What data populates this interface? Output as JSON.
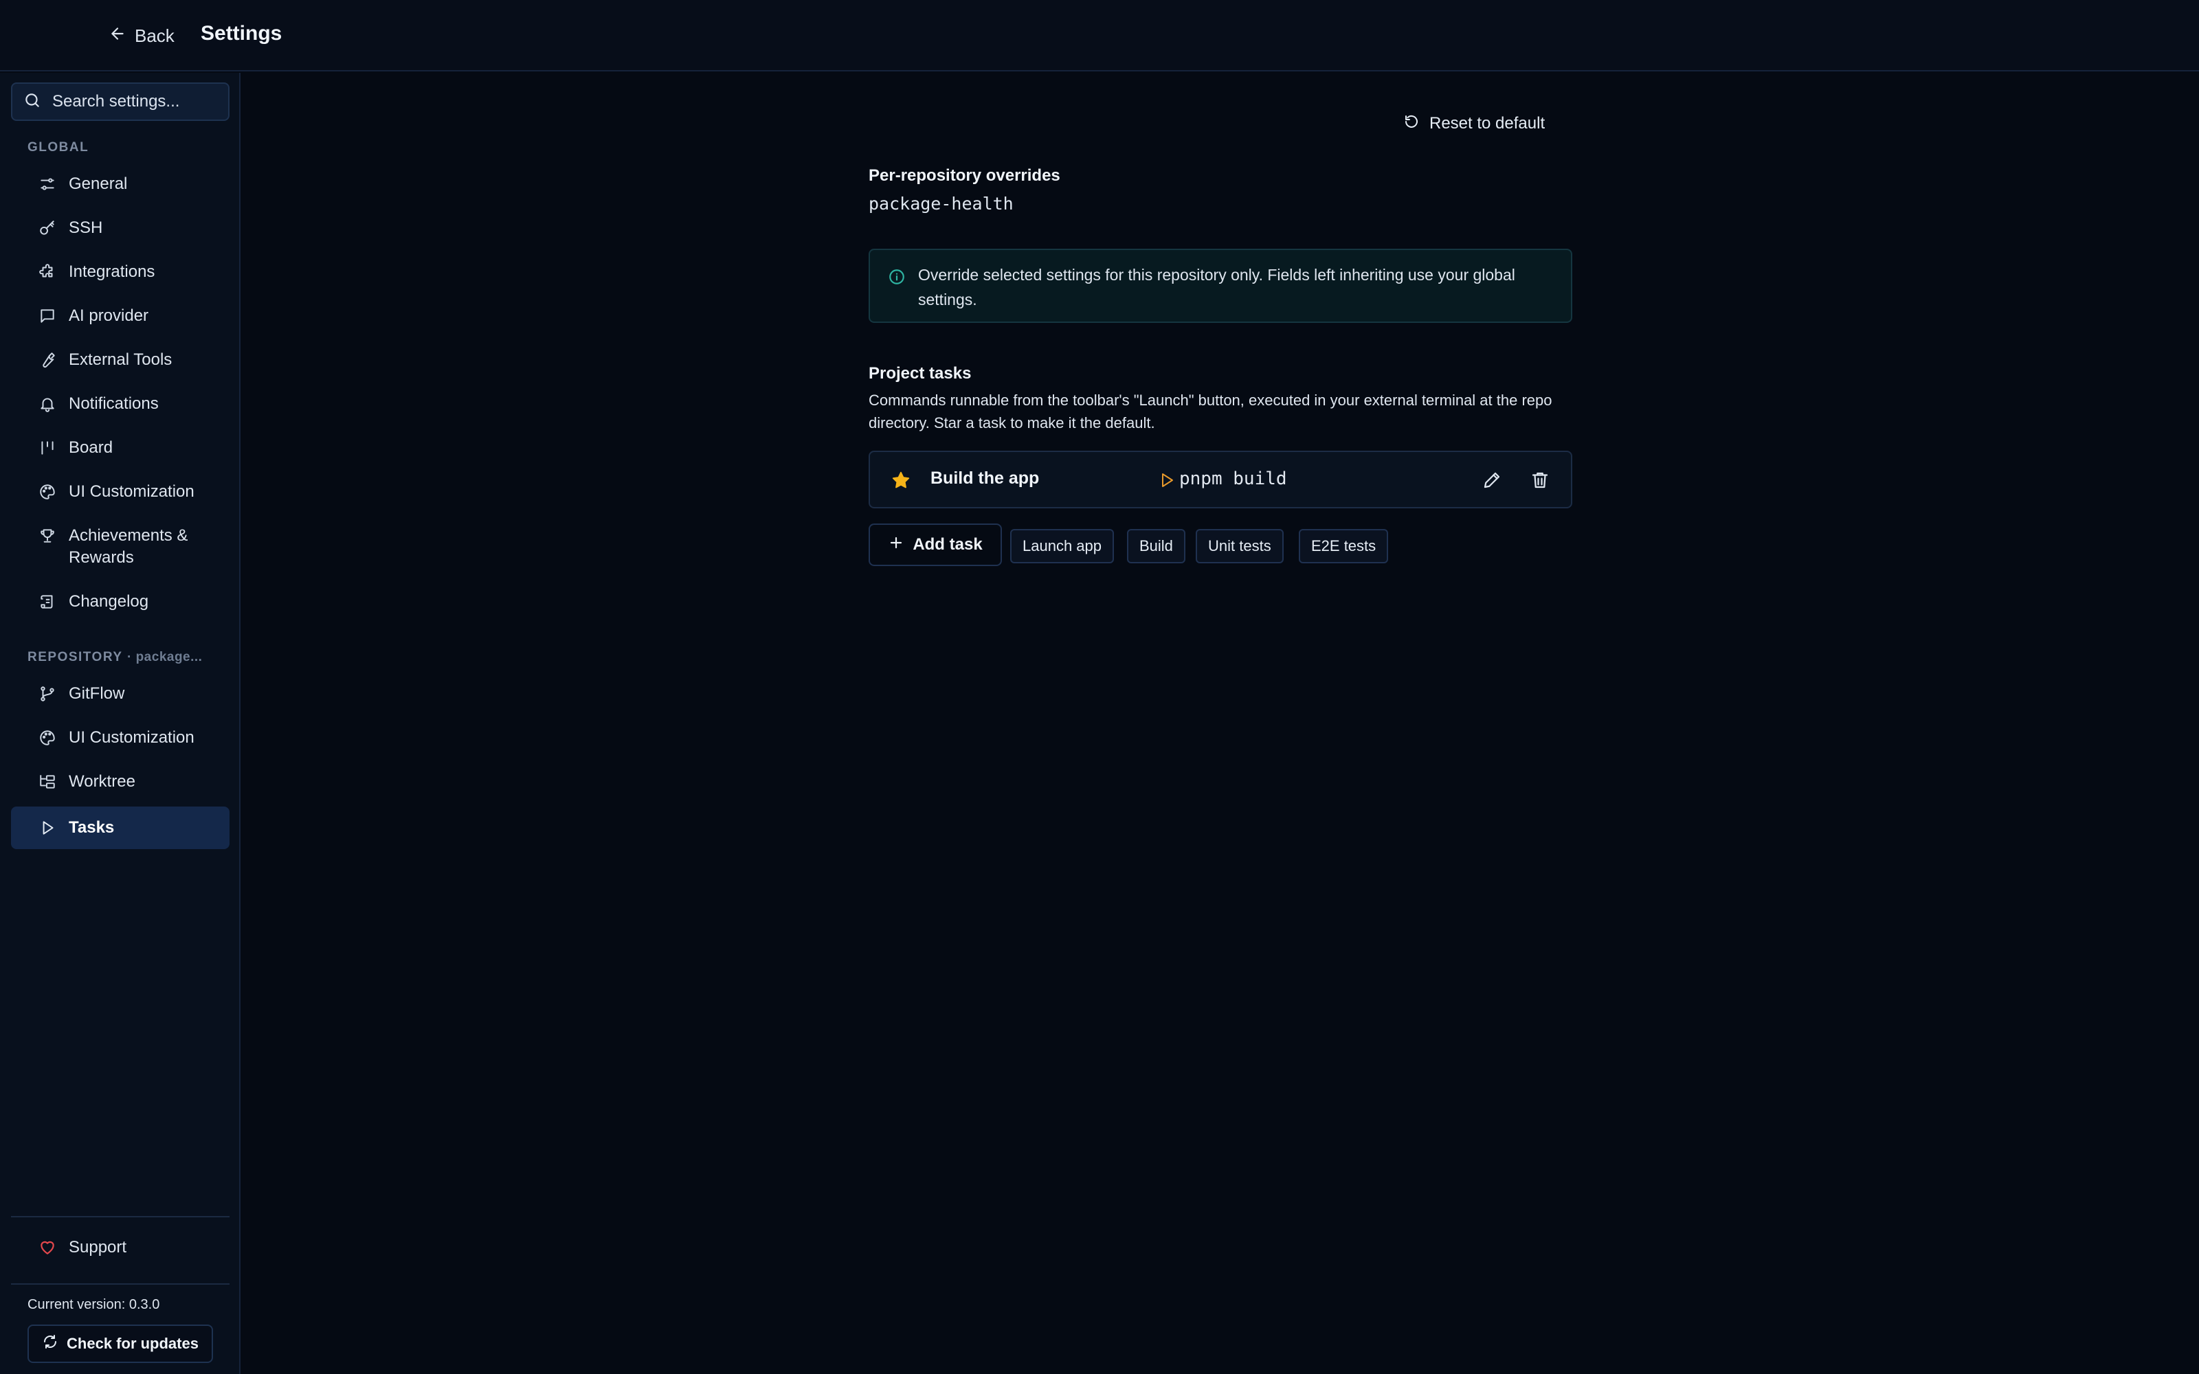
{
  "header": {
    "back_label": "Back",
    "title": "Settings"
  },
  "sidebar": {
    "search": {
      "placeholder": "Search settings..."
    },
    "global_label": "GLOBAL",
    "global_items": [
      {
        "label": "General",
        "icon": "sliders-icon"
      },
      {
        "label": "SSH",
        "icon": "key-icon"
      },
      {
        "label": "Integrations",
        "icon": "puzzle-icon"
      },
      {
        "label": "AI provider",
        "icon": "message-icon"
      },
      {
        "label": "External Tools",
        "icon": "wrench-icon"
      },
      {
        "label": "Notifications",
        "icon": "bell-icon"
      },
      {
        "label": "Board",
        "icon": "kanban-icon"
      },
      {
        "label": "UI Customization",
        "icon": "palette-icon"
      },
      {
        "label": "Achievements & Rewards",
        "icon": "trophy-icon"
      },
      {
        "label": "Changelog",
        "icon": "scroll-icon"
      }
    ],
    "repo_label": "REPOSITORY",
    "repo_sub": "· package...",
    "repo_items": [
      {
        "label": "GitFlow",
        "icon": "git-branch-icon"
      },
      {
        "label": "UI Customization",
        "icon": "palette-icon"
      },
      {
        "label": "Worktree",
        "icon": "folder-tree-icon"
      },
      {
        "label": "Tasks",
        "icon": "play-icon",
        "active": true
      }
    ],
    "support_label": "Support",
    "version_text": "Current version: 0.3.0",
    "check_updates_label": "Check for updates"
  },
  "main": {
    "reset_label": "Reset to default",
    "override_title": "Per-repository overrides",
    "repo_name": "package-health",
    "info_text": "Override selected settings for this repository only. Fields left inheriting use your global settings.",
    "tasks_title": "Project tasks",
    "tasks_desc": "Commands runnable from the toolbar's \"Launch\" button, executed in your external terminal at the repo directory. Star a task to make it the default.",
    "tasks": [
      {
        "name": "Build the app",
        "command": "pnpm build",
        "starred": true
      }
    ],
    "add_task_label": "Add task",
    "presets": [
      "Launch app",
      "Build",
      "Unit tests",
      "E2E tests"
    ]
  },
  "colors": {
    "background": "#050a13",
    "accent_star": "#f5b319",
    "accent_play": "#e89a2c",
    "info_icon": "#2fb5a3",
    "heart": "#e5484d",
    "active_nav": "#14284a"
  }
}
